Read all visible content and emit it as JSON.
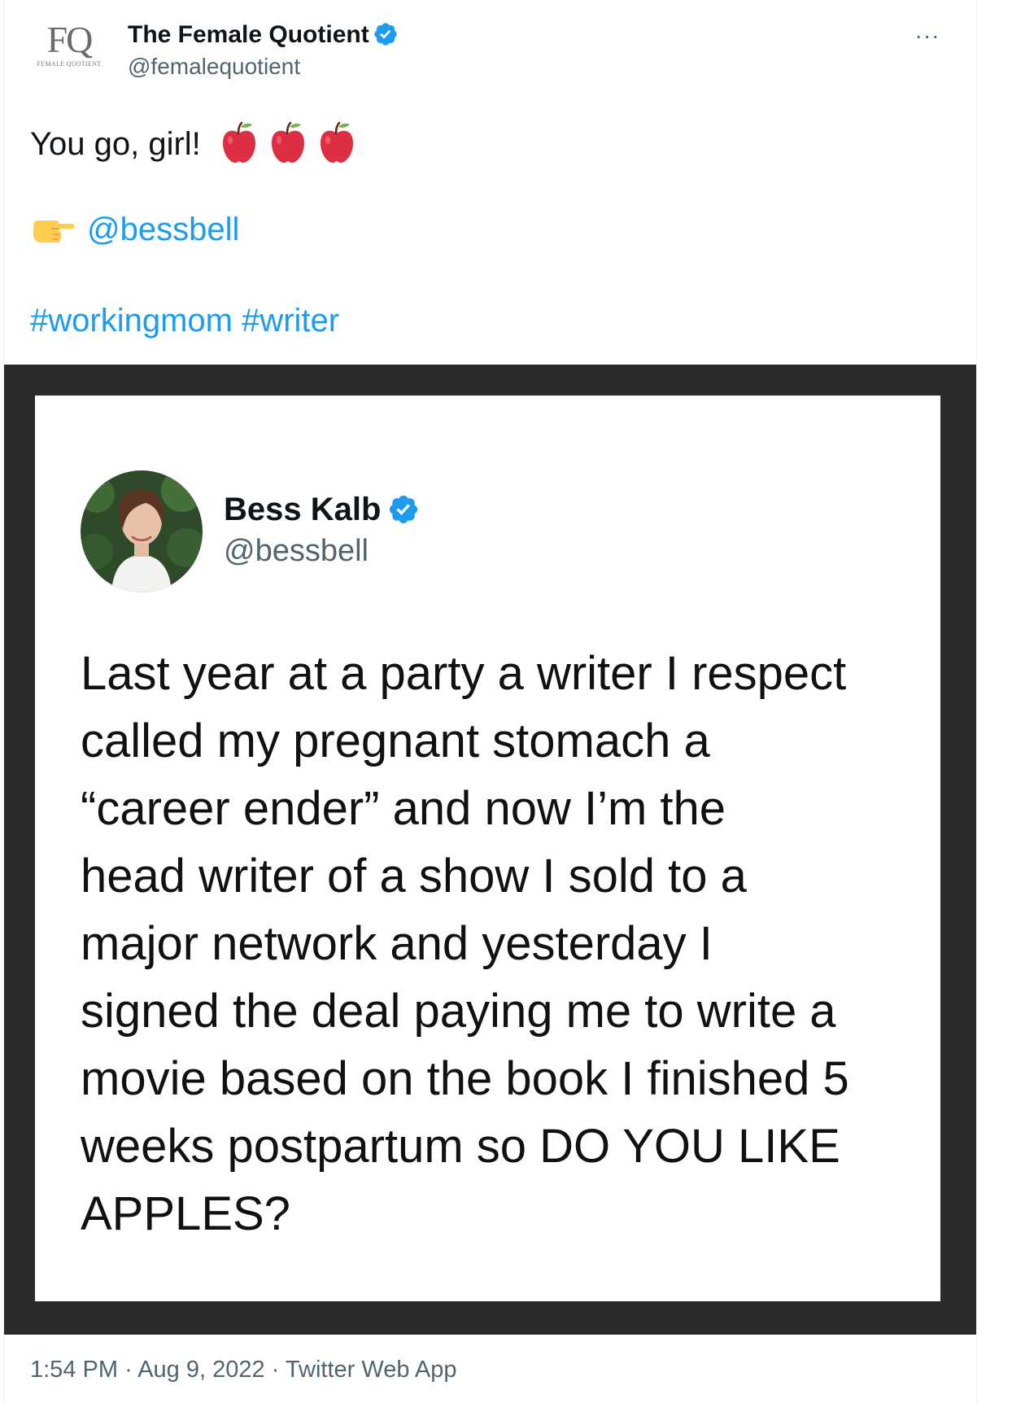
{
  "author": {
    "logo_text": "FQ",
    "logo_subtext": "FEMALE QUOTIENT",
    "name": "The Female Quotient",
    "handle": "@femalequotient"
  },
  "more_label": "···",
  "tweet": {
    "line1": "You go, girl!",
    "emoji_line1": [
      "apple-icon",
      "apple-icon",
      "apple-icon"
    ],
    "mention_icon": "pointing-right-icon",
    "mention": "@bessbell",
    "hashtag1": "#workingmom",
    "hashtag2": "#writer"
  },
  "quoted_image": {
    "name": "Bess Kalb",
    "handle": "@bessbell",
    "text": "Last year at a party a writer I respect\ncalled my pregnant stomach a\n“career ender” and now I’m the\nhead writer of a show I sold to a\nmajor network and yesterday I\nsigned the deal paying me to write a\nmovie based on the book I finished 5\nweeks postpartum so DO YOU LIKE\nAPPLES?"
  },
  "footer": {
    "time": "1:54 PM",
    "separator": "·",
    "date": "Aug 9, 2022",
    "source": "Twitter Web App"
  },
  "colors": {
    "link": "#1d9bf0",
    "secondary_text": "#536471",
    "verified": "#1d9bf0",
    "media_frame": "#2b2b2b"
  }
}
